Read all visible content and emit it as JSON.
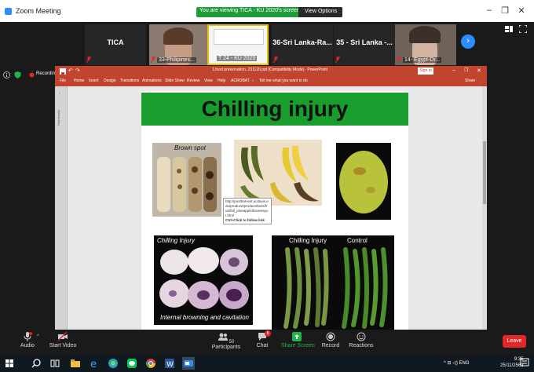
{
  "window": {
    "title": "Zoom Meeting",
    "minimize": "–",
    "maximize": "❐",
    "close": "✕"
  },
  "banner": {
    "text": "You are viewing TICA - KU 2020's screen",
    "options_label": "View Options"
  },
  "gallery": {
    "tiles": [
      {
        "name": "TICA"
      },
      {
        "name": "33-Philipines..."
      },
      {
        "name": "T 24 - KU 2020"
      },
      {
        "name": "36-Sri Lanka-Ra..."
      },
      {
        "name": "35 - Sri Lanka -..."
      },
      {
        "name": "14- Egypt-Dr..."
      }
    ]
  },
  "recording": {
    "label": "Recording"
  },
  "ppt": {
    "doc_title": "1.food preservation, 231120.ppt [Compatibility Mode] - PowerPoint",
    "sign_in": "Sign in",
    "share": "Share",
    "tabs": [
      "File",
      "Home",
      "Insert",
      "Design",
      "Transitions",
      "Animations",
      "Slide Show",
      "Review",
      "View",
      "Help",
      "ACROBAT"
    ],
    "tell_me": "Tell me what you want to do",
    "thumbnails_label": "Thumbnails"
  },
  "slide": {
    "title": "Chilling injury",
    "brown_spot_caption": "Brown spot",
    "tooltip_url": "http://postharvest.ucdavis.edu/produce/producefacts/fruit/fall_pineapple/brownspot.html",
    "tooltip_hint": "Ctrl+Click to follow link",
    "potato_caption_top": "Chilling Injury",
    "potato_caption_bottom": "Internal browning and cavitation",
    "beans_caption_left": "Chilling Injury",
    "beans_caption_right": "Control"
  },
  "toolbar": {
    "audio": "Audio",
    "video": "Start Video",
    "participants": "Participants",
    "participants_count": "50",
    "chat": "Chat",
    "chat_badge": "8",
    "share": "Share Screen",
    "record": "Record",
    "reactions": "Reactions",
    "leave": "Leave"
  },
  "taskbar": {
    "lang": "ENG",
    "time": "9:35",
    "date": "25/11/2563"
  },
  "colors": {
    "zoom_blue": "#2d8cff",
    "banner_green": "#1f9d3a",
    "ppt_red": "#c0442e",
    "slide_title_green": "#199d2d",
    "leave_red": "#e02828"
  }
}
